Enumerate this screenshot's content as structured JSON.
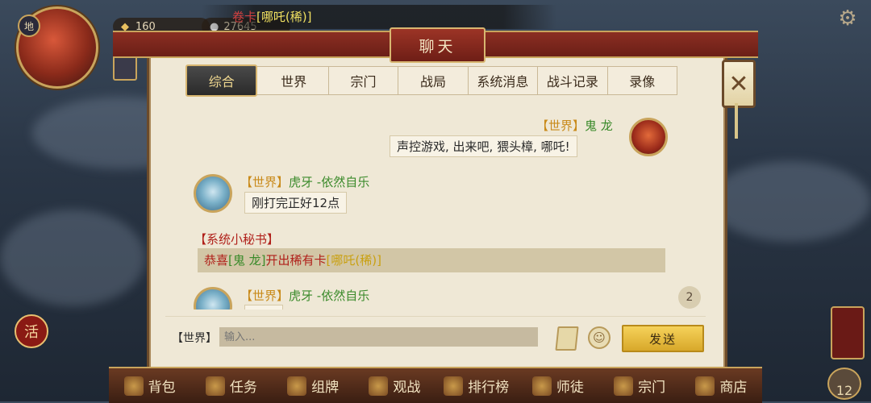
{
  "hud": {
    "avatar_badge": "地",
    "resource_1": "160",
    "resource_2": "27645",
    "banner_prefix": "卷卡",
    "banner_highlight": "[哪吒(稀)]"
  },
  "dialog": {
    "title": "聊天",
    "tabs": [
      {
        "label": "综合",
        "active": true
      },
      {
        "label": "世界",
        "active": false
      },
      {
        "label": "宗门",
        "active": false
      },
      {
        "label": "战局",
        "active": false
      },
      {
        "label": "系统消息",
        "active": false
      },
      {
        "label": "战斗记录",
        "active": false
      },
      {
        "label": "录像",
        "active": false
      }
    ],
    "close_glyph": "✕"
  },
  "messages": [
    {
      "channel": "【世界】",
      "sender": "鬼 龙",
      "text": "声控游戏, 出来吧, 猥头樟, 哪吒!"
    },
    {
      "channel": "【世界】",
      "sender": "虎牙 -依然自乐",
      "text": "刚打完正好12点"
    },
    {
      "channel": "【世界】",
      "sender": "虎牙 -依然自乐",
      "text": ""
    }
  ],
  "system": {
    "header": "【系统小秘书】",
    "part1": "恭喜",
    "part2": "[鬼 龙]",
    "part3": "开出稀有卡",
    "part4": "[哪吒(稀)]"
  },
  "unread_count": "2",
  "input": {
    "channel": "【世界】",
    "placeholder": "输入...",
    "send_label": "发送"
  },
  "bottom_nav": [
    {
      "label": "背包"
    },
    {
      "label": "任务"
    },
    {
      "label": "组牌"
    },
    {
      "label": "观战"
    },
    {
      "label": "排行榜"
    },
    {
      "label": "师徒"
    },
    {
      "label": "宗门"
    },
    {
      "label": "商店"
    }
  ],
  "side": {
    "left_seal": "活",
    "right_count": "12"
  },
  "colors": {
    "world_tag": "#c98a1a",
    "name_green": "#3a8a2a",
    "system_red": "#b0201a",
    "rare_gold": "#c9a010"
  }
}
